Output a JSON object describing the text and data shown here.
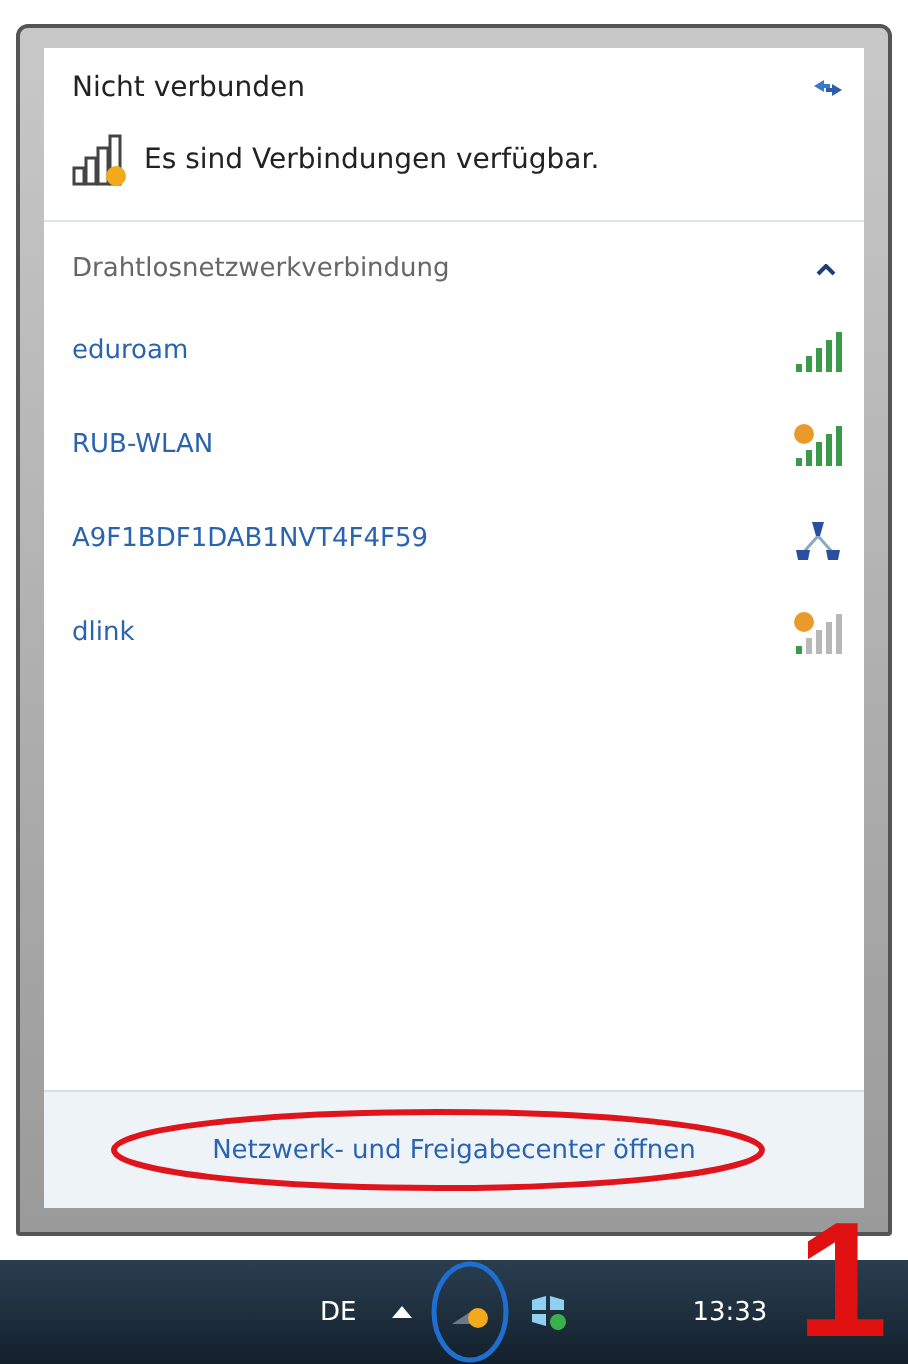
{
  "header": {
    "title": "Nicht verbunden",
    "status": "Es sind Verbindungen verfügbar."
  },
  "section": {
    "title": "Drahtlosnetzwerkverbindung",
    "expanded": true
  },
  "networks": [
    {
      "name": "eduroam",
      "kind": "open"
    },
    {
      "name": "RUB-WLAN",
      "kind": "shielded"
    },
    {
      "name": "A9F1BDF1DAB1NVT4F4F59",
      "kind": "adhoc"
    },
    {
      "name": "dlink",
      "kind": "weak"
    }
  ],
  "footer": {
    "link": "Netzwerk- und Freigabecenter öffnen",
    "highlighted": true
  },
  "taskbar": {
    "language": "DE",
    "clock": "13:33",
    "network_highlighted": true
  },
  "step_number": "1"
}
